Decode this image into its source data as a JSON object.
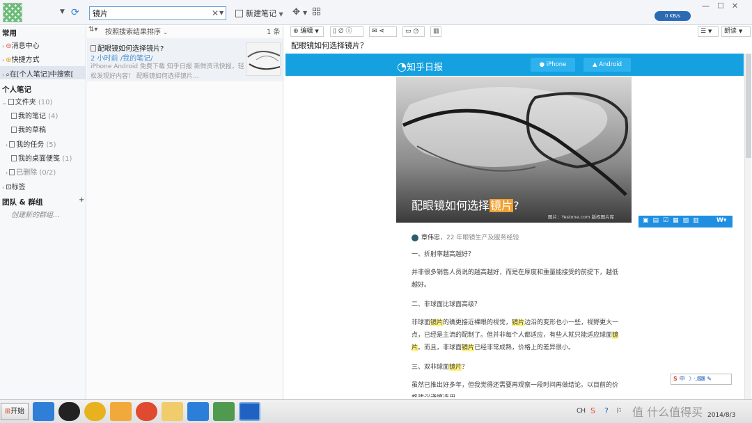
{
  "topbar": {
    "search_value": "镜片",
    "new_note_label": "新建笔记"
  },
  "net": {
    "speed": "0 KB/s"
  },
  "sidebar": {
    "section_common": "常用",
    "item_messages": "消息中心",
    "item_shortcuts": "快捷方式",
    "item_search_scope": "在[个人笔记]中搜索[",
    "section_personal": "个人笔记",
    "folder_label": "文件夹",
    "folder_count": "(10)",
    "my_notes": "我的笔记",
    "my_notes_count": "(4)",
    "drafts": "我的草稿",
    "tasks": "我的任务",
    "tasks_count": "(5)",
    "desktop_notes": "我的桌面便笺",
    "desktop_notes_count": "(1)",
    "deleted": "已删除",
    "deleted_count": "(0/2)",
    "tags": "标签",
    "section_team": "团队 & 群组",
    "add_icon": "+",
    "create_group": "创建新的群组..."
  },
  "list": {
    "sort_label": "按照搜索结果排序",
    "count": "1 条",
    "card": {
      "title": "配眼镜如何选择镜片?",
      "time": "2 小时前 /我的笔记/",
      "snippet": "iPhone Android 免费下载 知乎日报 新鲜资讯快报，轻松发现好内容！ 配眼镜如何选择镜片..."
    }
  },
  "reader": {
    "edit_label": "编辑",
    "read_label": "朗读",
    "title": "配眼镜如何选择镜片？"
  },
  "article": {
    "site_name": "知乎日报",
    "iphone_label": "iPhone",
    "android_label": "Android",
    "hero_title_pre": "配眼镜如何选择",
    "hero_title_hl": "镜片",
    "hero_title_post": "?",
    "hero_credit": "图片：Yestone.com 版权图片库",
    "author": "章伟忠",
    "author_desc": "，22 年眼镜生产及服务经验",
    "q1": "一、折射率越高越好？",
    "p1": "并非很多销售人员说的越高越好，而是在厚度和重量能接受的前提下，越低越好。",
    "q2": "二、非球面比球面高级？",
    "p2_a": "非球面",
    "p2_b": "镜片",
    "p2_c": "的确更接近裸眼的视觉，",
    "p2_d": "镜片",
    "p2_e": "边沿的变形也小一些，视野更大一点，已经是主流的配制了。但并非每个人都适应，有些人就只能适应球面",
    "p2_f": "镜片",
    "p2_g": "。而且，非球面",
    "p2_h": "镜片",
    "p2_i": "已经非常成熟，价格上的差异很小。",
    "q3_a": "三、双非球面",
    "q3_b": "镜片",
    "q3_c": "？",
    "p3": "虽然已推出好多年，但我觉得还需要再观察一段时间再做结论。以目前的价格建议谨慎选用。"
  },
  "ime": {
    "label": "中"
  },
  "taskbar": {
    "start_label": "开始",
    "input_lang": "CH",
    "time": "",
    "date": "2014/8/3",
    "watermark": "值 什么值得买"
  },
  "colors": {
    "zhihu_blue": "#15a1e0",
    "highlight": "#fff280",
    "hero_highlight": "#f0a030",
    "accent": "#2b7fd8"
  }
}
